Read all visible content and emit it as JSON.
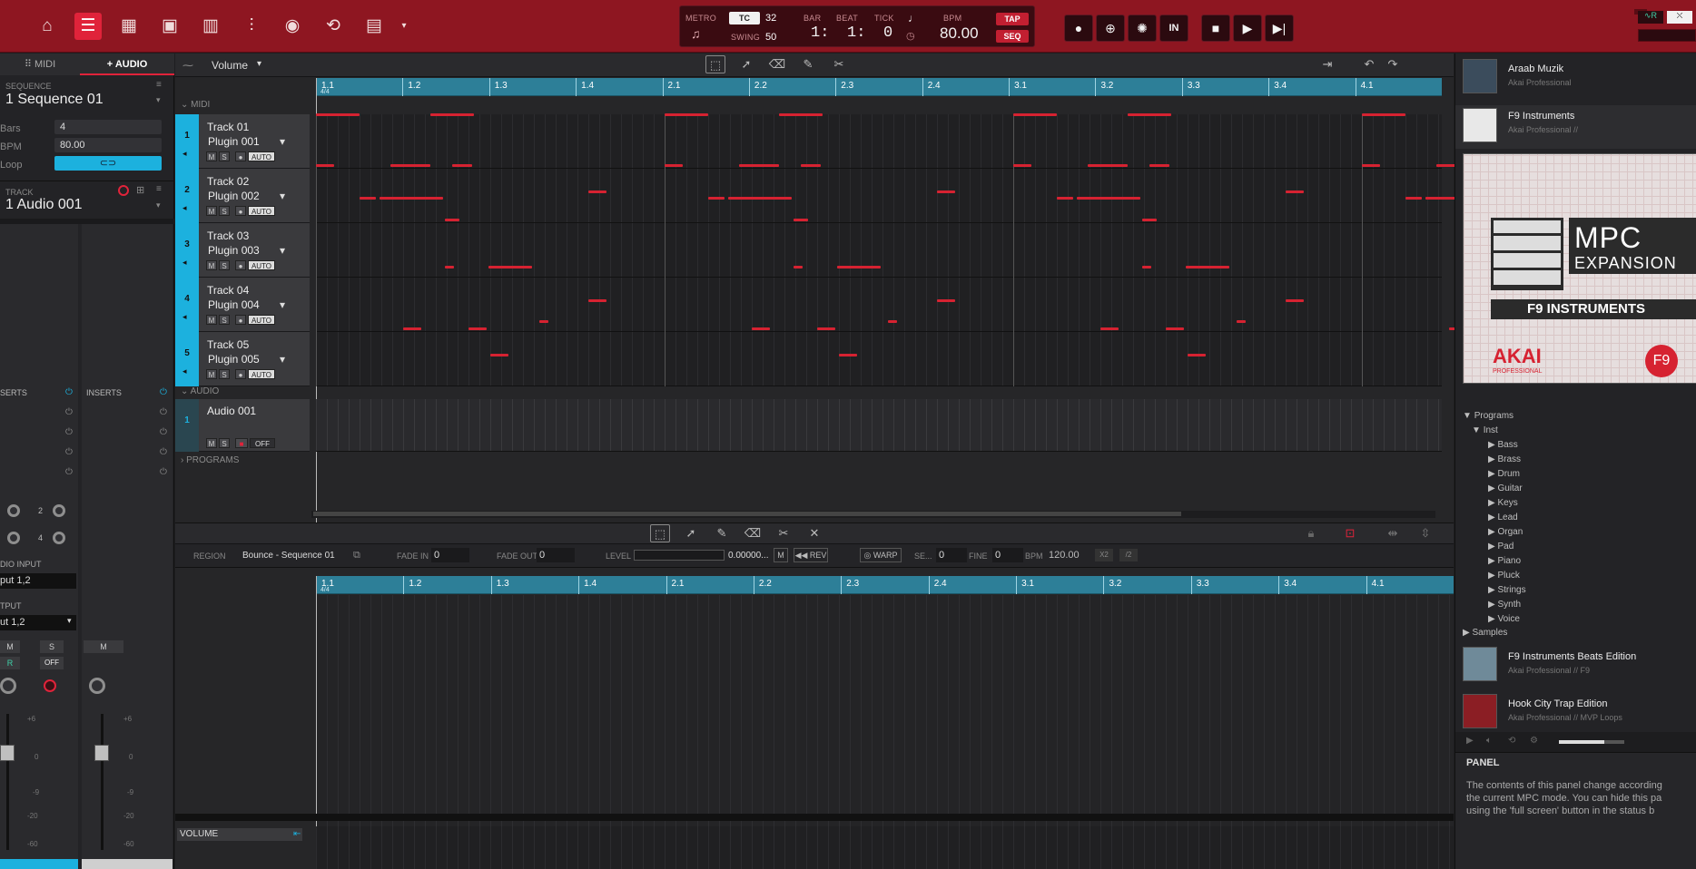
{
  "topbar": {
    "metro_label": "METRO",
    "tc_label": "TC",
    "tc_value": "32",
    "swing_label": "SWING",
    "swing_value": "50",
    "bar_label": "BAR",
    "beat_label": "BEAT",
    "tick_label": "TICK",
    "bar_value": "1:",
    "beat_value": "1:",
    "tick_value": "0",
    "bpm_label": "BPM",
    "bpm_value": "80.00",
    "tap_label": "TAP",
    "seq_label": "SEQ",
    "in_label": "IN"
  },
  "left": {
    "tab_midi": "MIDI",
    "tab_audio": "AUDIO",
    "sequence_label": "SEQUENCE",
    "sequence_value": "1 Sequence 01",
    "bars_label": "Bars",
    "bars_value": "4",
    "bpm_label": "BPM",
    "bpm_value": "80.00",
    "loop_label": "Loop",
    "track_label": "TRACK",
    "track_value": "1 Audio 001",
    "inserts_left": "SERTS",
    "inserts_right": "INSERTS",
    "audio_input_label": "DIO INPUT",
    "audio_input_value": "put 1,2",
    "output_label": "TPUT",
    "output_value": "ut 1,2",
    "m_label": "M",
    "s_label": "S",
    "off_label": "OFF",
    "r_label": "R",
    "ch2": "2",
    "ch4": "4",
    "db_plus6": "+6",
    "db_0": "0",
    "db_m9": "-9",
    "db_m20": "-20",
    "db_m60": "-60"
  },
  "main": {
    "param_select": "Volume",
    "section_midi": "MIDI",
    "section_audio": "AUDIO",
    "section_programs": "PROGRAMS",
    "ruler_labels": [
      "1.1",
      "1.2",
      "1.3",
      "1.4",
      "2.1",
      "2.2",
      "2.3",
      "2.4",
      "3.1",
      "3.2",
      "3.3",
      "3.4",
      "4.1"
    ],
    "ruler_sub": "4/4",
    "tracks": [
      {
        "num": "1",
        "name": "Track 01",
        "plugin": "Plugin 001"
      },
      {
        "num": "2",
        "name": "Track 02",
        "plugin": "Plugin 002"
      },
      {
        "num": "3",
        "name": "Track 03",
        "plugin": "Plugin 003"
      },
      {
        "num": "4",
        "name": "Track 04",
        "plugin": "Plugin 004"
      },
      {
        "num": "5",
        "name": "Track 05",
        "plugin": "Plugin 005"
      }
    ],
    "audio_track": {
      "num": "1",
      "name": "Audio 001",
      "off": "OFF"
    },
    "mini_m": "M",
    "mini_s": "S",
    "mini_auto": "AUTO",
    "region_label": "REGION",
    "region_value": "Bounce - Sequence 01",
    "fade_in_label": "FADE IN",
    "fade_in_value": "0",
    "fade_out_label": "FADE OUT",
    "fade_out_value": "0",
    "level_label": "LEVEL",
    "level_value": "0.00000...",
    "level_m": "M",
    "rev_label": "REV",
    "warp_label": "WARP",
    "se_label": "SE...",
    "se_value": "0",
    "fine_label": "FINE",
    "fine_value": "0",
    "bpm_label": "BPM",
    "bpm_value": "120.00",
    "x2_label": "X2",
    "div2_label": "/2",
    "volume_label": "VOLUME"
  },
  "right": {
    "item1_title": "Araab Muzik",
    "item1_sub": "Akai Professional",
    "item2_title": "F9 Instruments",
    "item2_sub": "Akai Professional //",
    "art_line1": "MPC",
    "art_line2": "EXPANSION",
    "art_line3": "F9 INSTRUMENTS",
    "art_brand": "AKAI",
    "art_brand_sub": "PROFESSIONAL",
    "art_badge": "F9",
    "tree_programs": "Programs",
    "tree_inst": "Inst",
    "tree_items": [
      "Bass",
      "Brass",
      "Drum",
      "Guitar",
      "Keys",
      "Lead",
      "Organ",
      "Pad",
      "Piano",
      "Pluck",
      "Strings",
      "Synth",
      "Voice"
    ],
    "tree_samples": "Samples",
    "item3_title": "F9 Instruments Beats Edition",
    "item3_sub": "Akai Professional // F9",
    "item4_title": "Hook City Trap Edition",
    "item4_sub": "Akai Professional // MVP Loops",
    "panel_label": "PANEL",
    "panel_text_1": "The contents of this panel change according",
    "panel_text_2": "the current MPC mode. You can hide this pa",
    "panel_text_3": "using the 'full screen' button in the status b"
  },
  "colors": {
    "topbar": "#8e1621",
    "accent_red": "#e0233a",
    "track_blue": "#1cb1de",
    "ruler": "#2d7f98",
    "note": "#d62231"
  }
}
